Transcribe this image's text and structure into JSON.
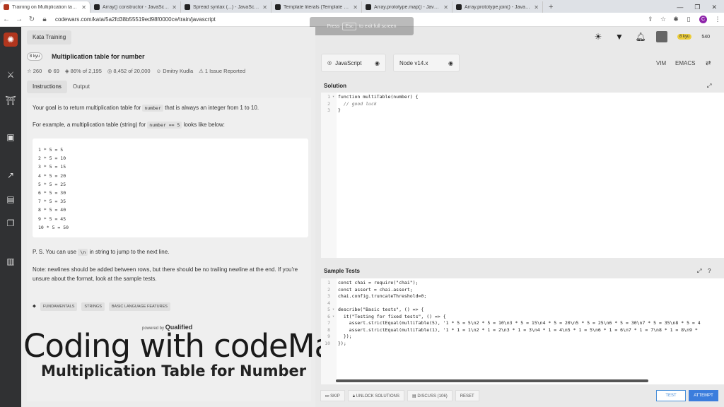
{
  "browser": {
    "tabs": [
      {
        "title": "Training on Multiplication table for",
        "active": true,
        "fav": "codewars"
      },
      {
        "title": "Array() constructor - JavaScript | M",
        "active": false,
        "fav": "mdn"
      },
      {
        "title": "Spread syntax (...) - JavaScript | M",
        "active": false,
        "fav": "mdn"
      },
      {
        "title": "Template literals (Template strings",
        "active": false,
        "fav": "mdn"
      },
      {
        "title": "Array.prototype.map() - JavaScript |",
        "active": false,
        "fav": "mdn"
      },
      {
        "title": "Array.prototype.join() - JavaScript",
        "active": false,
        "fav": "mdn"
      }
    ],
    "new_tab": "+",
    "url": "codewars.com/kata/5a2fd38b55519ed98f0000ce/train/javascript",
    "profile_initial": "C",
    "fullscreen_notice": {
      "before": "Press",
      "key": "Esc",
      "after": "to exit full screen"
    }
  },
  "header": {
    "breadcrumb": "Kata Training",
    "rank": "8 kyu",
    "honor": "540"
  },
  "kata": {
    "kyu": "8 kyu",
    "title": "Multiplication table for number",
    "stats": {
      "stars": "260",
      "collections": "69",
      "satisfaction": "86% of 2,195",
      "completions": "8,452 of 20,000",
      "author": "Dmitry Kudla",
      "issues": "1 Issue Reported"
    },
    "tabs": {
      "instructions": "Instructions",
      "output": "Output"
    },
    "desc": {
      "p1_pre": "Your goal is to return multiplication table for",
      "p1_code": "number",
      "p1_post": "that is always an integer from 1 to 10.",
      "p2_pre": "For example, a multiplication table (string) for",
      "p2_code": "number == 5",
      "p2_post": "looks like below:",
      "example": [
        "1 * 5 = 5",
        "2 * 5 = 10",
        "3 * 5 = 15",
        "4 * 5 = 20",
        "5 * 5 = 25",
        "6 * 5 = 30",
        "7 * 5 = 35",
        "8 * 5 = 40",
        "9 * 5 = 45",
        "10 * 5 = 50"
      ],
      "p3_pre": "P. S. You can use",
      "p3_code": "\\n",
      "p3_post": "in string to jump to the next line.",
      "p4": "Note: newlines should be added between rows, but there should be no trailing newline at the end. If you're unsure about the format, look at the sample tests."
    },
    "tags": [
      "FUNDAMENTALS",
      "STRINGS",
      "BASIC LANGUAGE FEATURES"
    ],
    "powered_by": "powered by",
    "powered_brand": "Qualified"
  },
  "overlay": {
    "title": "Coding with codeManS",
    "subtitle": "Multiplication Table for Number"
  },
  "toolbar": {
    "language": "JavaScript",
    "version": "Node v14.x",
    "vim": "VIM",
    "emacs": "EMACS"
  },
  "solution": {
    "heading": "Solution",
    "lines": [
      {
        "n": "1",
        "fold": "▾",
        "code": "function multiTable(number) {",
        "cmt": false
      },
      {
        "n": "2",
        "fold": "",
        "code": "  // good luck",
        "cmt": true
      },
      {
        "n": "3",
        "fold": "",
        "code": "}",
        "cmt": false
      }
    ]
  },
  "sample_tests": {
    "heading": "Sample Tests",
    "lines": [
      {
        "n": "1",
        "fold": "",
        "code": "const chai = require(\"chai\");"
      },
      {
        "n": "2",
        "fold": "",
        "code": "const assert = chai.assert;"
      },
      {
        "n": "3",
        "fold": "",
        "code": "chai.config.truncateThreshold=0;"
      },
      {
        "n": "4",
        "fold": "",
        "code": ""
      },
      {
        "n": "5",
        "fold": "▾",
        "code": "describe(\"Basic tests\", () => {"
      },
      {
        "n": "6",
        "fold": "▾",
        "code": "  it(\"Testing for fixed tests\", () => {"
      },
      {
        "n": "7",
        "fold": "",
        "code": "    assert.strictEqual(multiTable(5), '1 * 5 = 5\\n2 * 5 = 10\\n3 * 5 = 15\\n4 * 5 = 20\\n5 * 5 = 25\\n6 * 5 = 30\\n7 * 5 = 35\\n8 * 5 = 4"
      },
      {
        "n": "8",
        "fold": "",
        "code": "    assert.strictEqual(multiTable(1), '1 * 1 = 1\\n2 * 1 = 2\\n3 * 1 = 3\\n4 * 1 = 4\\n5 * 1 = 5\\n6 * 1 = 6\\n7 * 1 = 7\\n8 * 1 = 8\\n9 *"
      },
      {
        "n": "9",
        "fold": "",
        "code": "  });"
      },
      {
        "n": "10",
        "fold": "",
        "code": "});"
      }
    ]
  },
  "actions": {
    "skip": "SKIP",
    "unlock": "UNLOCK SOLUTIONS",
    "discuss": "DISCUSS (106)",
    "reset": "RESET",
    "test": "TEST",
    "attempt": "ATTEMPT"
  }
}
